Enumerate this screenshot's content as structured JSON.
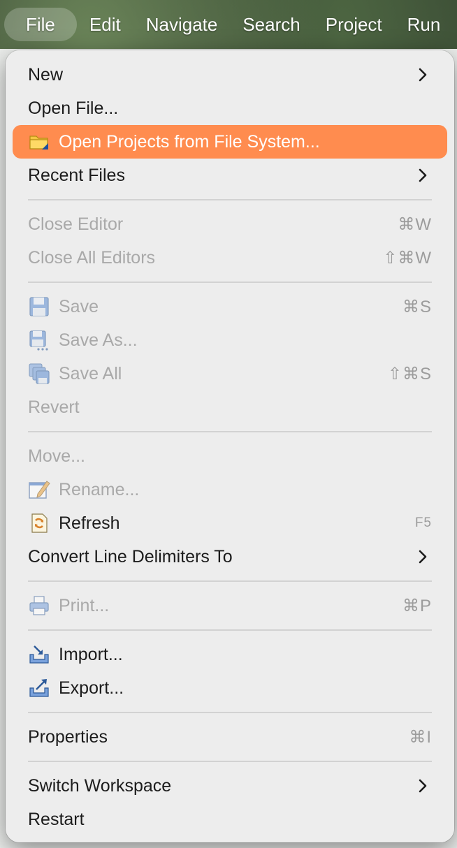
{
  "menubar": {
    "items": [
      "File",
      "Edit",
      "Navigate",
      "Search",
      "Project",
      "Run"
    ]
  },
  "file_menu": {
    "new": {
      "label": "New"
    },
    "open_file": {
      "label": "Open File..."
    },
    "open_projects": {
      "label": "Open Projects from File System..."
    },
    "recent_files": {
      "label": "Recent Files"
    },
    "close_editor": {
      "label": "Close Editor",
      "shortcut": "⌘W"
    },
    "close_all_editors": {
      "label": "Close All Editors",
      "shortcut": "⇧⌘W"
    },
    "save": {
      "label": "Save",
      "shortcut": "⌘S"
    },
    "save_as": {
      "label": "Save As..."
    },
    "save_all": {
      "label": "Save All",
      "shortcut": "⇧⌘S"
    },
    "revert": {
      "label": "Revert"
    },
    "move": {
      "label": "Move..."
    },
    "rename": {
      "label": "Rename..."
    },
    "refresh": {
      "label": "Refresh",
      "shortcut": "F5"
    },
    "convert_line_delimiters": {
      "label": "Convert Line Delimiters To"
    },
    "print": {
      "label": "Print...",
      "shortcut": "⌘P"
    },
    "import": {
      "label": "Import..."
    },
    "export": {
      "label": "Export..."
    },
    "properties": {
      "label": "Properties",
      "shortcut": "⌘I"
    },
    "switch_workspace": {
      "label": "Switch Workspace"
    },
    "restart": {
      "label": "Restart"
    }
  },
  "colors": {
    "highlight": "#ff8c4f",
    "disabled_text": "#a9a9a9",
    "menu_background": "#ececec"
  }
}
